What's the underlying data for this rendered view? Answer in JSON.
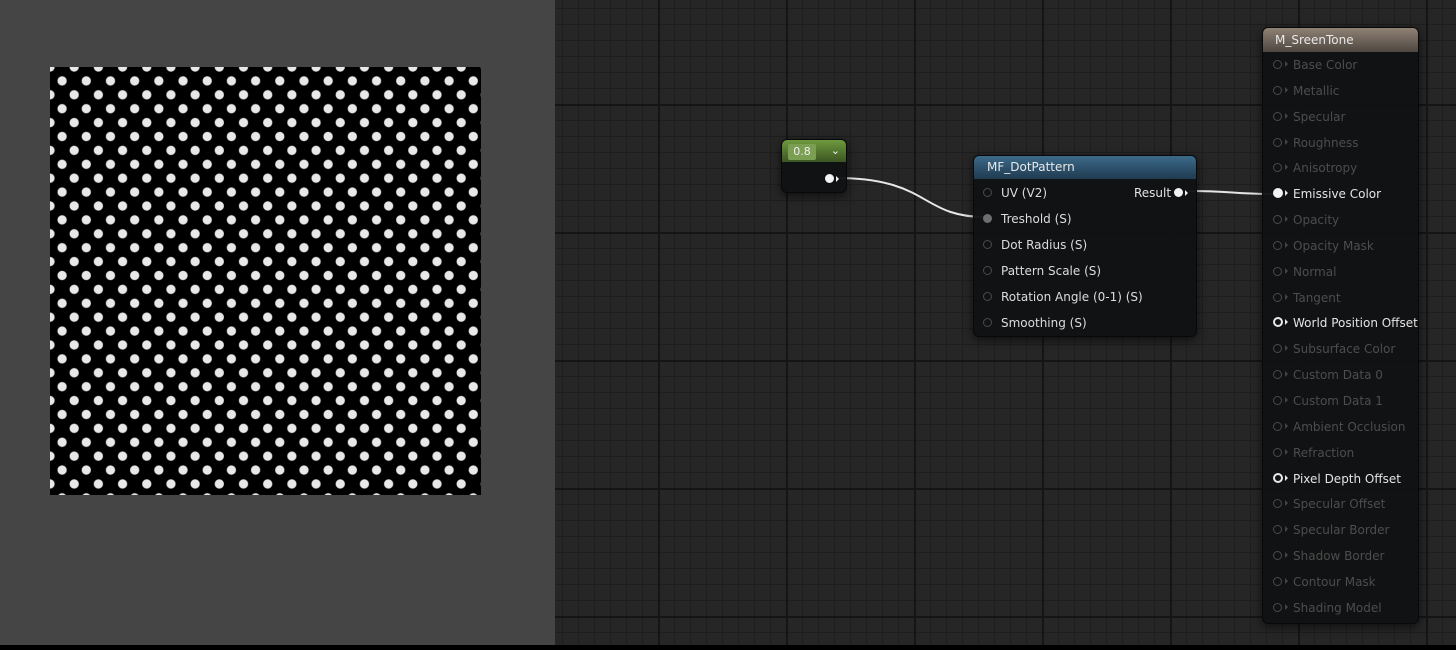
{
  "colors": {
    "preview_background": "#454545",
    "graph_background": "#262626",
    "constant_header": "#6e9a3e",
    "function_header": "#3c6a8a",
    "material_header": "#8f8174",
    "connected_pin": "#f2f2f2",
    "dim_text": "#4d4d4d"
  },
  "preview": {
    "pattern": "white-dots-on-black"
  },
  "constant_node": {
    "value": "0.8",
    "chevron_icon": "chevron-down-icon"
  },
  "function_node": {
    "title": "MF_DotPattern",
    "inputs": [
      {
        "label": "UV (V2)",
        "connected": false
      },
      {
        "label": "Treshold (S)",
        "connected": true
      },
      {
        "label": "Dot Radius (S)",
        "connected": false
      },
      {
        "label": "Pattern Scale (S)",
        "connected": false
      },
      {
        "label": "Rotation Angle (0-1) (S)",
        "connected": false
      },
      {
        "label": "Smoothing (S)",
        "connected": false
      }
    ],
    "output": {
      "label": "Result",
      "connected": true
    }
  },
  "material_node": {
    "title": "M_SreenTone",
    "inputs": [
      {
        "label": "Base Color",
        "state": "dim"
      },
      {
        "label": "Metallic",
        "state": "dim"
      },
      {
        "label": "Specular",
        "state": "dim"
      },
      {
        "label": "Roughness",
        "state": "dim"
      },
      {
        "label": "Anisotropy",
        "state": "dim"
      },
      {
        "label": "Emissive Color",
        "state": "connected"
      },
      {
        "label": "Opacity",
        "state": "dim"
      },
      {
        "label": "Opacity Mask",
        "state": "dim"
      },
      {
        "label": "Normal",
        "state": "dim"
      },
      {
        "label": "Tangent",
        "state": "dim"
      },
      {
        "label": "World Position Offset",
        "state": "active"
      },
      {
        "label": "Subsurface Color",
        "state": "dim"
      },
      {
        "label": "Custom Data 0",
        "state": "dim"
      },
      {
        "label": "Custom Data 1",
        "state": "dim"
      },
      {
        "label": "Ambient Occlusion",
        "state": "dim"
      },
      {
        "label": "Refraction",
        "state": "dim"
      },
      {
        "label": "Pixel Depth Offset",
        "state": "active"
      },
      {
        "label": "Specular Offset",
        "state": "dim"
      },
      {
        "label": "Specular Border",
        "state": "dim"
      },
      {
        "label": "Shadow Border",
        "state": "dim"
      },
      {
        "label": "Contour Mask",
        "state": "dim"
      },
      {
        "label": "Shading Model",
        "state": "dim"
      }
    ]
  }
}
